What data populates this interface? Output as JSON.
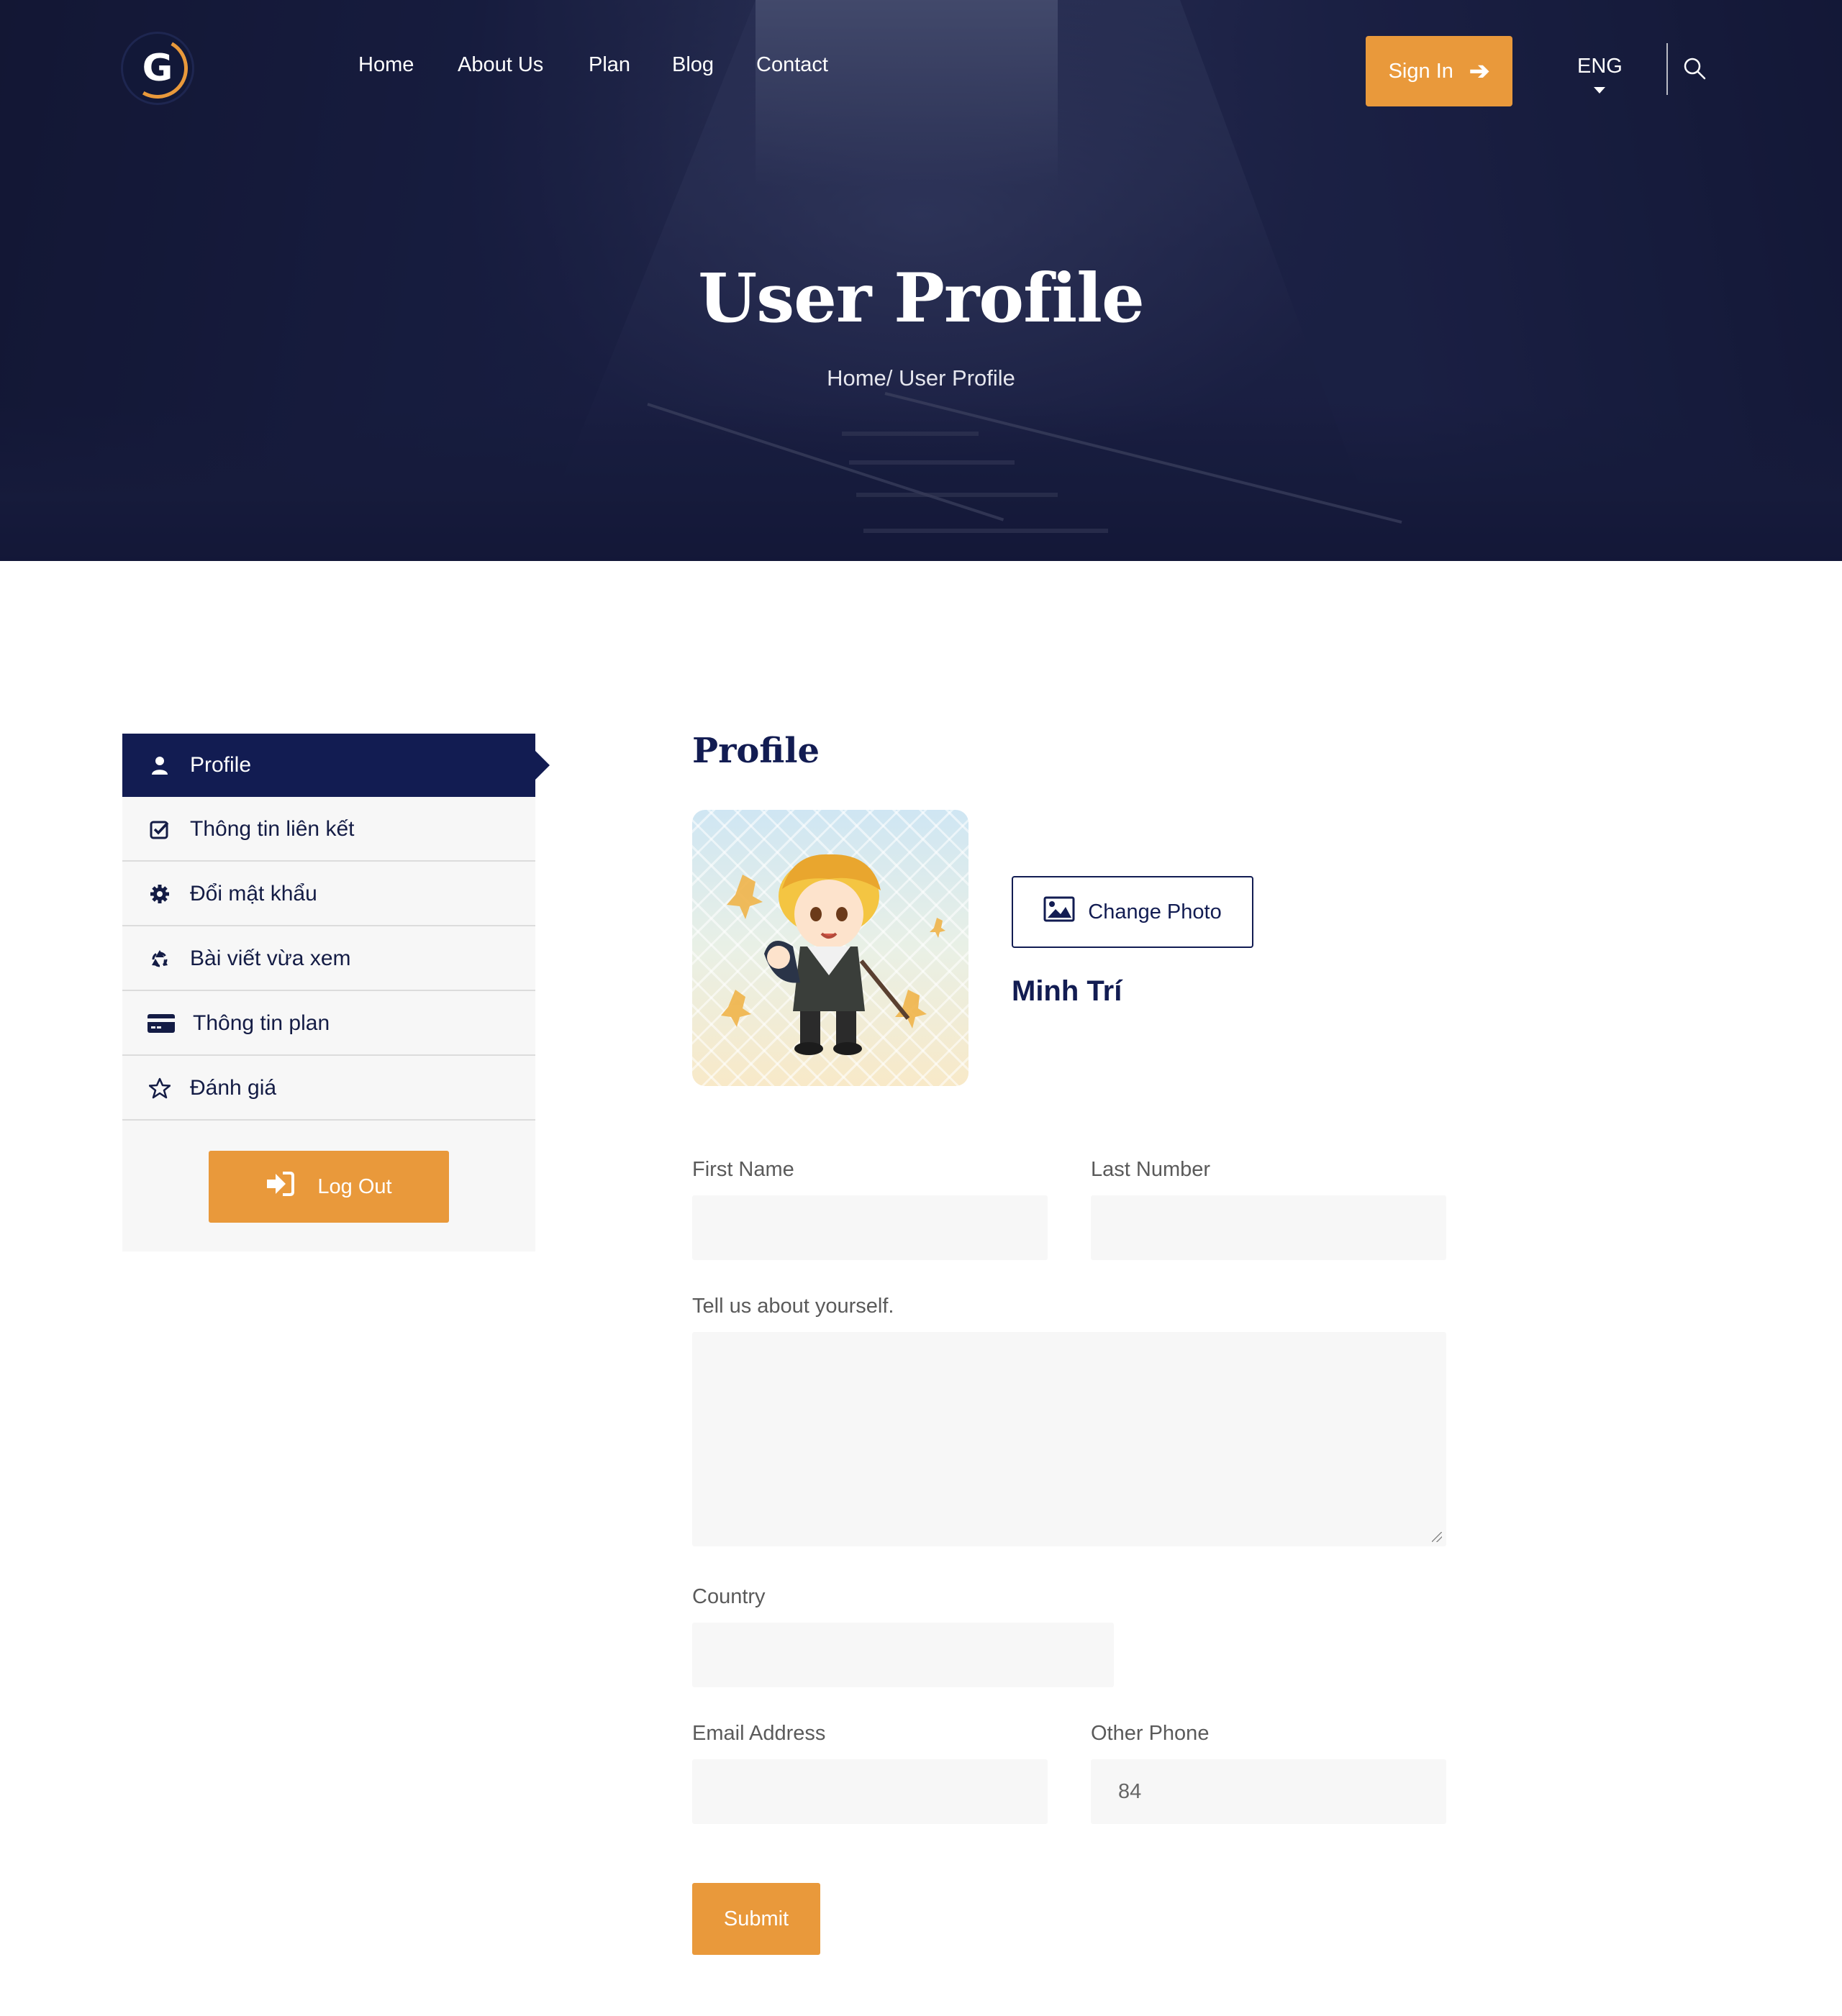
{
  "header": {
    "logo_letter": "G",
    "nav": [
      {
        "label": "Home"
      },
      {
        "label": "About Us"
      },
      {
        "label": "Plan"
      },
      {
        "label": "Blog"
      },
      {
        "label": "Contact"
      }
    ],
    "signin_label": "Sign In",
    "language": "ENG"
  },
  "hero": {
    "title": "User Profile",
    "breadcrumb": "Home/ User Profile"
  },
  "sidebar": {
    "items": [
      {
        "label": "Profile",
        "icon": "user-icon",
        "active": true
      },
      {
        "label": "Thông tin liên kết",
        "icon": "check-square-icon"
      },
      {
        "label": "Đổi mật khẩu",
        "icon": "gear-icon"
      },
      {
        "label": "Bài viết vừa xem",
        "icon": "recycle-icon"
      },
      {
        "label": "Thông tin plan",
        "icon": "credit-card-icon"
      },
      {
        "label": "Đánh giá",
        "icon": "star-icon"
      }
    ],
    "logout_label": "Log Out"
  },
  "profile": {
    "section_title": "Profile",
    "change_photo_label": "Change Photo",
    "user_name": "Minh Trí"
  },
  "form": {
    "first_name": {
      "label": "First Name",
      "value": ""
    },
    "last_name": {
      "label": "Last Number",
      "value": ""
    },
    "about": {
      "label": "Tell us about yourself.",
      "value": ""
    },
    "country": {
      "label": "Country",
      "value": ""
    },
    "email": {
      "label": "Email Address",
      "value": ""
    },
    "phone": {
      "label": "Other Phone",
      "value": "84"
    },
    "submit_label": "Submit"
  },
  "colors": {
    "accent": "#e9993b",
    "navy": "#121c52",
    "field_bg": "#f7f7f7"
  }
}
